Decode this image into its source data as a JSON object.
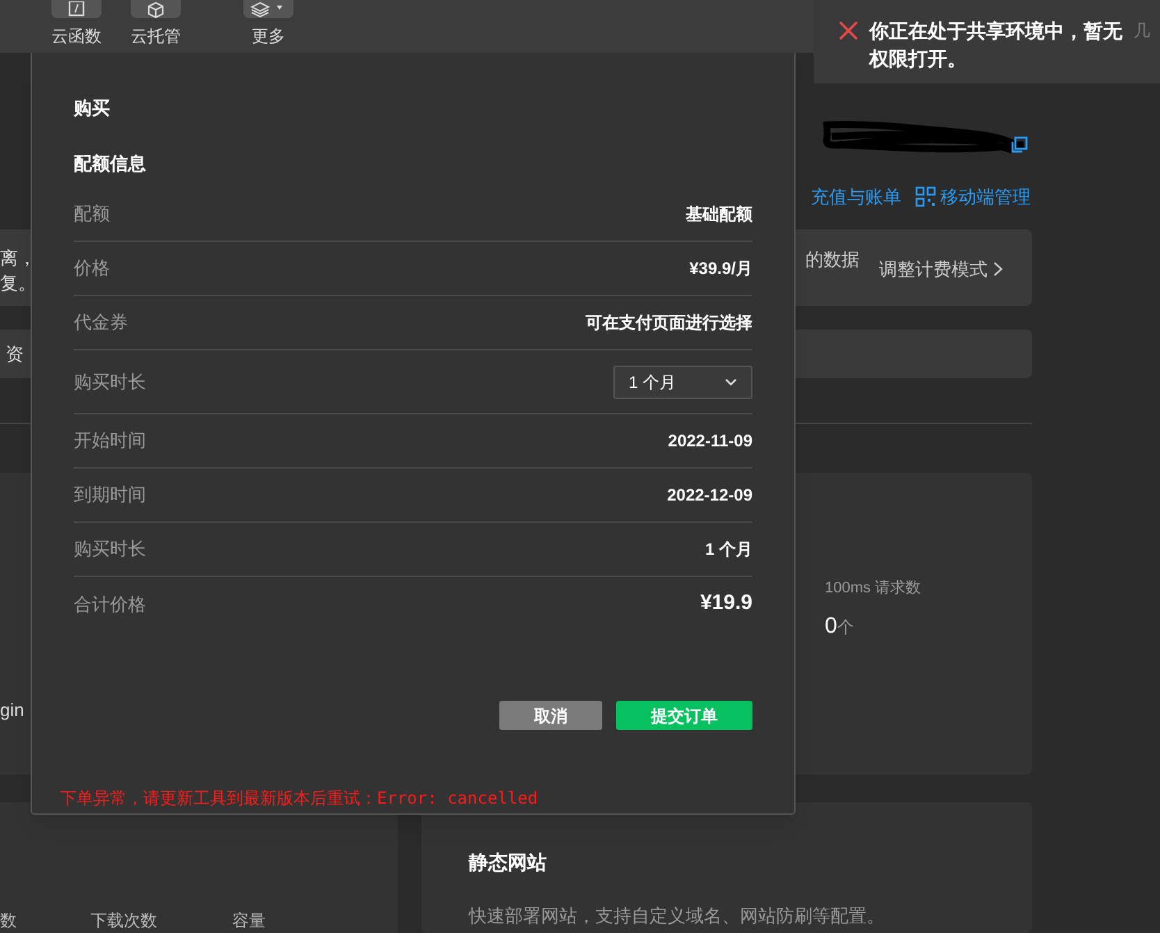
{
  "toolbar": {
    "items": [
      {
        "label": "云函数"
      },
      {
        "label": "云托管"
      },
      {
        "label": "更多"
      }
    ]
  },
  "notification": {
    "lines": [
      "你正在处于共享环境中，暂无",
      "权限打开。"
    ],
    "trailing": "几"
  },
  "account": {
    "links": [
      "充值与账单",
      "移动端管理"
    ]
  },
  "background": {
    "left_fragments": [
      "离，",
      "复。",
      "资",
      "gin"
    ],
    "table_headers": [
      "数",
      "下载次数",
      "容量"
    ],
    "billing_note": "的数据",
    "billing_link": "调整计费模式",
    "metric": {
      "label": "100ms 请求数",
      "value": "0",
      "unit": "个"
    },
    "static_site": {
      "title": "静态网站",
      "description": "快速部署网站，支持自定义域名、网站防刷等配置。"
    }
  },
  "dialog": {
    "title": "购买",
    "section": "配额信息",
    "rows": [
      {
        "kind": "text",
        "label": "配额",
        "value": "基础配额"
      },
      {
        "kind": "text",
        "label": "价格",
        "value": "¥39.9/月"
      },
      {
        "kind": "text",
        "label": "代金券",
        "value": "可在支付页面进行选择"
      },
      {
        "kind": "select",
        "label": "购买时长",
        "value": "1 个月"
      },
      {
        "kind": "text",
        "label": "开始时间",
        "value": "2022-11-09"
      },
      {
        "kind": "text",
        "label": "到期时间",
        "value": "2022-12-09"
      },
      {
        "kind": "text",
        "label": "购买时长",
        "value": "1 个月"
      },
      {
        "kind": "total",
        "label": "合计价格",
        "value": "¥19.9"
      }
    ],
    "buttons": [
      {
        "kind": "secondary",
        "label": "取消"
      },
      {
        "kind": "primary",
        "label": "提交订单"
      }
    ],
    "error": "下单异常，请更新工具到最新版本后重试：Error: cancelled"
  }
}
